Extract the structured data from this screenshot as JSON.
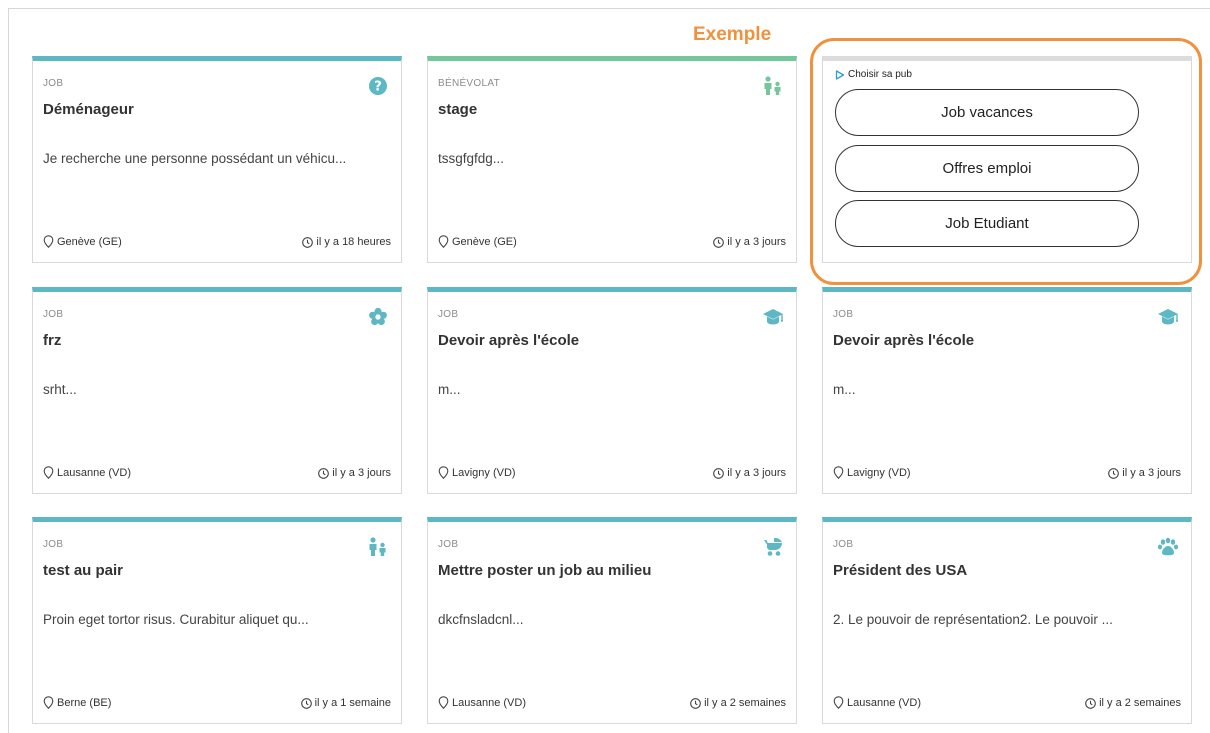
{
  "annotation": {
    "label": "Exemple"
  },
  "ad": {
    "choose_label": "Choisir sa pub",
    "buttons": [
      "Job vacances",
      "Offres emploi",
      "Job Etudiant"
    ]
  },
  "cards": [
    {
      "type": "JOB",
      "title": "Déménageur",
      "desc": "Je recherche une personne possédant un véhicu...",
      "location": "Genève (GE)",
      "time": "il y a 18 heures",
      "icon": "question-circle-icon",
      "accent": "#5db7c4"
    },
    {
      "type": "BÉNÉVOLAT",
      "title": "stage",
      "desc": "tssgfgfdg...",
      "location": "Genève (GE)",
      "time": "il y a 3 jours",
      "icon": "parent-child-icon",
      "accent": "#74c79a"
    },
    {
      "type": "JOB",
      "title": "frz",
      "desc": "srht...",
      "location": "Lausanne (VD)",
      "time": "il y a 3 jours",
      "icon": "flower-icon",
      "accent": "#5db7c4"
    },
    {
      "type": "JOB",
      "title": "Devoir après l'école",
      "desc": "m...",
      "location": "Lavigny (VD)",
      "time": "il y a 3 jours",
      "icon": "graduation-cap-icon",
      "accent": "#5db7c4"
    },
    {
      "type": "JOB",
      "title": "Devoir après l'école",
      "desc": "m...",
      "location": "Lavigny (VD)",
      "time": "il y a 3 jours",
      "icon": "graduation-cap-icon",
      "accent": "#5db7c4"
    },
    {
      "type": "JOB",
      "title": "test au pair",
      "desc": "Proin eget tortor risus. Curabitur aliquet qu...",
      "location": "Berne (BE)",
      "time": "il y a 1 semaine",
      "icon": "parent-child-icon",
      "accent": "#5db7c4"
    },
    {
      "type": "JOB",
      "title": "Mettre poster un job au milieu",
      "desc": "dkcfnsladcnl...",
      "location": "Lausanne (VD)",
      "time": "il y a 2 semaines",
      "icon": "baby-stroller-icon",
      "accent": "#5db7c4"
    },
    {
      "type": "JOB",
      "title": "Président des USA",
      "desc": "2. Le pouvoir de représentation2. Le pouvoir ...",
      "location": "Lausanne (VD)",
      "time": "il y a 2 semaines",
      "icon": "paw-icon",
      "accent": "#5db7c4"
    }
  ]
}
